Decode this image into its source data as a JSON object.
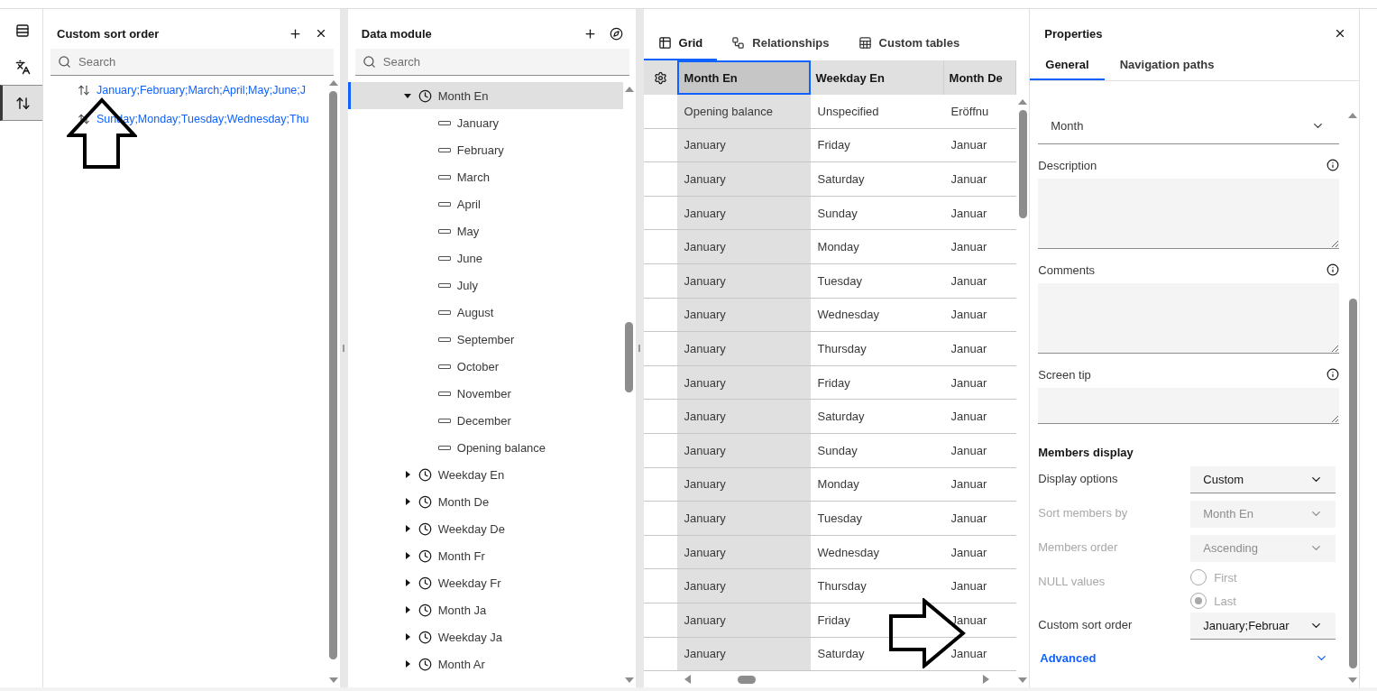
{
  "rail": [
    {
      "kind": "table",
      "selected": false
    },
    {
      "kind": "translate",
      "selected": false
    },
    {
      "kind": "sort",
      "selected": true
    }
  ],
  "sort_panel": {
    "title": "Custom sort order",
    "search": {
      "placeholder": "Search"
    },
    "items": [
      "January;February;March;April;May;June;J",
      "Sunday;Monday;Tuesday;Wednesday;Thu"
    ]
  },
  "data_module": {
    "title": "Data module",
    "search": {
      "placeholder": "Search"
    },
    "tree": [
      {
        "label": "Month En",
        "expanded": true,
        "selected": true,
        "children": [
          {
            "label": "January"
          },
          {
            "label": "February"
          },
          {
            "label": "March"
          },
          {
            "label": "April"
          },
          {
            "label": "May"
          },
          {
            "label": "June"
          },
          {
            "label": "July"
          },
          {
            "label": "August"
          },
          {
            "label": "September"
          },
          {
            "label": "October"
          },
          {
            "label": "November"
          },
          {
            "label": "December"
          },
          {
            "label": "Opening balance"
          }
        ]
      },
      {
        "label": "Weekday En",
        "expanded": false,
        "selected": false
      },
      {
        "label": "Month De",
        "expanded": false,
        "selected": false
      },
      {
        "label": "Weekday De",
        "expanded": false,
        "selected": false
      },
      {
        "label": "Month Fr",
        "expanded": false,
        "selected": false
      },
      {
        "label": "Weekday Fr",
        "expanded": false,
        "selected": false
      },
      {
        "label": "Month Ja",
        "expanded": false,
        "selected": false
      },
      {
        "label": "Weekday Ja",
        "expanded": false,
        "selected": false
      },
      {
        "label": "Month Ar",
        "expanded": false,
        "selected": false
      }
    ]
  },
  "view_tabs": [
    {
      "label": "Grid",
      "kind": "grid",
      "selected": true
    },
    {
      "label": "Relationships",
      "kind": "relationships",
      "selected": false
    },
    {
      "label": "Custom tables",
      "kind": "custom",
      "selected": false
    }
  ],
  "grid": {
    "columns": [
      {
        "label": "Month En",
        "selected": true
      },
      {
        "label": "Weekday En",
        "selected": false
      },
      {
        "label": "Month De",
        "selected": false
      }
    ],
    "rows": [
      [
        "Opening balance",
        "Unspecified",
        "Eröffnu"
      ],
      [
        "January",
        "Friday",
        "Januar"
      ],
      [
        "January",
        "Saturday",
        "Januar"
      ],
      [
        "January",
        "Sunday",
        "Januar"
      ],
      [
        "January",
        "Monday",
        "Januar"
      ],
      [
        "January",
        "Tuesday",
        "Januar"
      ],
      [
        "January",
        "Wednesday",
        "Januar"
      ],
      [
        "January",
        "Thursday",
        "Januar"
      ],
      [
        "January",
        "Friday",
        "Januar"
      ],
      [
        "January",
        "Saturday",
        "Januar"
      ],
      [
        "January",
        "Sunday",
        "Januar"
      ],
      [
        "January",
        "Monday",
        "Januar"
      ],
      [
        "January",
        "Tuesday",
        "Januar"
      ],
      [
        "January",
        "Wednesday",
        "Januar"
      ],
      [
        "January",
        "Thursday",
        "Januar"
      ],
      [
        "January",
        "Friday",
        "Januar"
      ],
      [
        "January",
        "Saturday",
        "Januar"
      ]
    ]
  },
  "properties": {
    "title": "Properties",
    "tabs": [
      {
        "label": "General",
        "selected": true
      },
      {
        "label": "Navigation paths",
        "selected": false
      }
    ],
    "type_select": "Month",
    "text_areas": [
      {
        "label": "Description"
      },
      {
        "label": "Comments"
      },
      {
        "label": "Screen tip"
      }
    ],
    "section": "Members display",
    "fields": [
      {
        "kind": "select",
        "label": "Display options",
        "value": "Custom",
        "disabled": false
      },
      {
        "kind": "select",
        "label": "Sort members by",
        "value": "Month En",
        "disabled": true
      },
      {
        "kind": "select",
        "label": "Members order",
        "value": "Ascending",
        "disabled": true
      },
      {
        "kind": "radio",
        "label": "NULL values",
        "disabled": true,
        "options": [
          {
            "label": "First",
            "selected": false
          },
          {
            "label": "Last",
            "selected": true
          }
        ]
      },
      {
        "kind": "select",
        "label": "Custom sort order",
        "value": "January;Februar",
        "disabled": false
      }
    ],
    "advanced": "Advanced"
  }
}
